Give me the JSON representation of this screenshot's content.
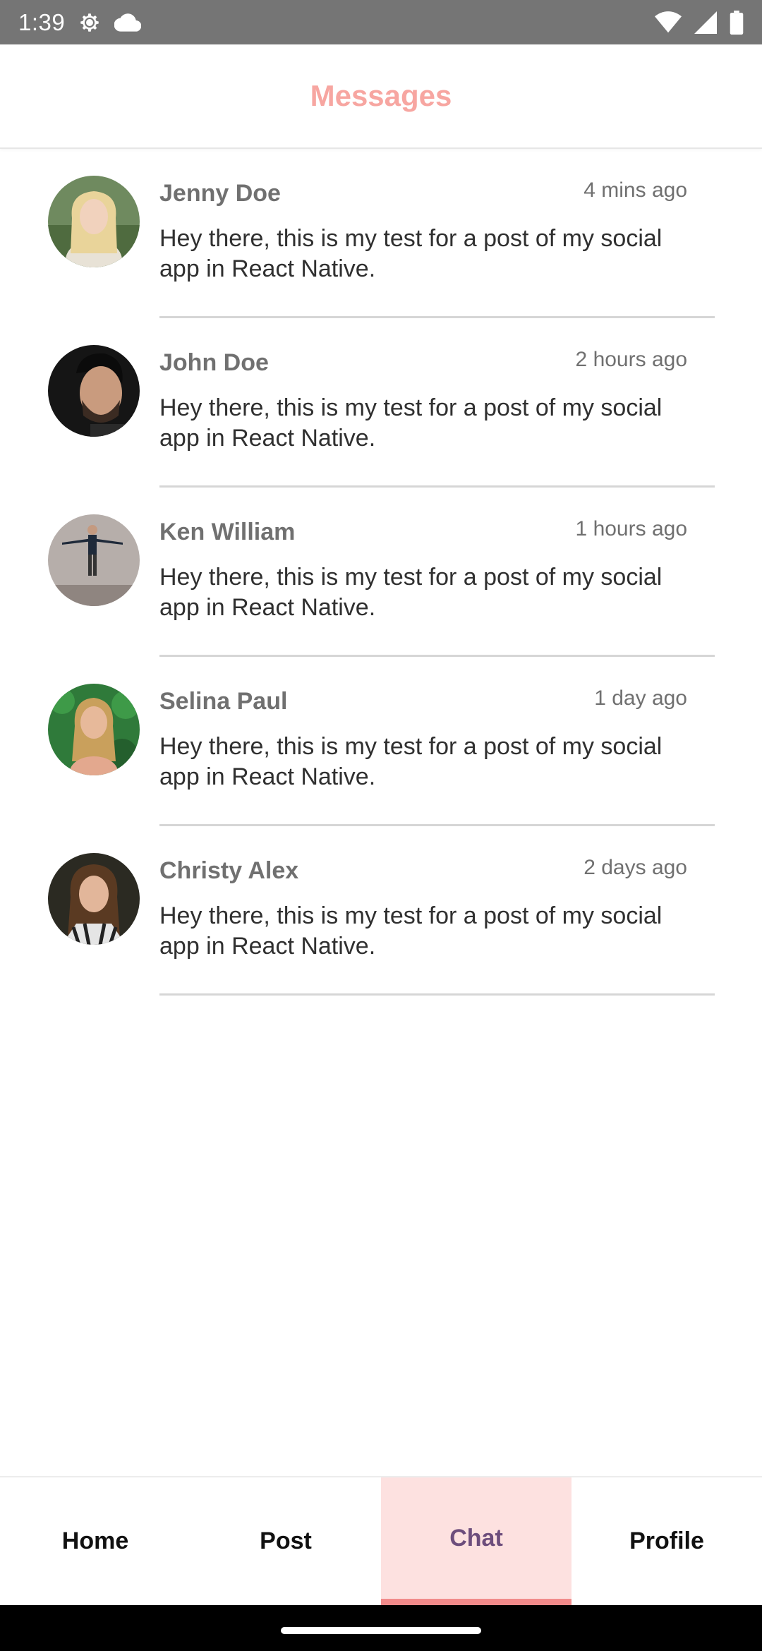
{
  "status_bar": {
    "time": "1:39",
    "icons": [
      "settings-icon",
      "cloud-icon",
      "wifi-icon",
      "signal-icon",
      "battery-icon"
    ],
    "background": "#757575"
  },
  "header": {
    "title": "Messages",
    "title_color": "#f7a6a1"
  },
  "messages": [
    {
      "name": "Jenny Doe",
      "time": "4 mins ago",
      "text": "Hey there, this is my test for a post of my social app in React Native.",
      "avatar": "avatar-jenny-doe"
    },
    {
      "name": "John Doe",
      "time": "2 hours ago",
      "text": "Hey there, this is my test for a post of my social app in React Native.",
      "avatar": "avatar-john-doe"
    },
    {
      "name": "Ken William",
      "time": "1 hours ago",
      "text": "Hey there, this is my test for a post of my social app in React Native.",
      "avatar": "avatar-ken-william"
    },
    {
      "name": "Selina Paul",
      "time": "1 day ago",
      "text": "Hey there, this is my test for a post of my social app in React Native.",
      "avatar": "avatar-selina-paul"
    },
    {
      "name": "Christy Alex",
      "time": "2 days ago",
      "text": "Hey there, this is my test for a post of my social app in React Native.",
      "avatar": "avatar-christy-alex"
    }
  ],
  "tabs": [
    {
      "label": "Home",
      "active": false
    },
    {
      "label": "Post",
      "active": false
    },
    {
      "label": "Chat",
      "active": true
    },
    {
      "label": "Profile",
      "active": false
    }
  ],
  "colors": {
    "active_tab_bg": "#fde1e0",
    "active_tab_text": "#6d4d7c",
    "active_indicator": "#f28b8b"
  }
}
